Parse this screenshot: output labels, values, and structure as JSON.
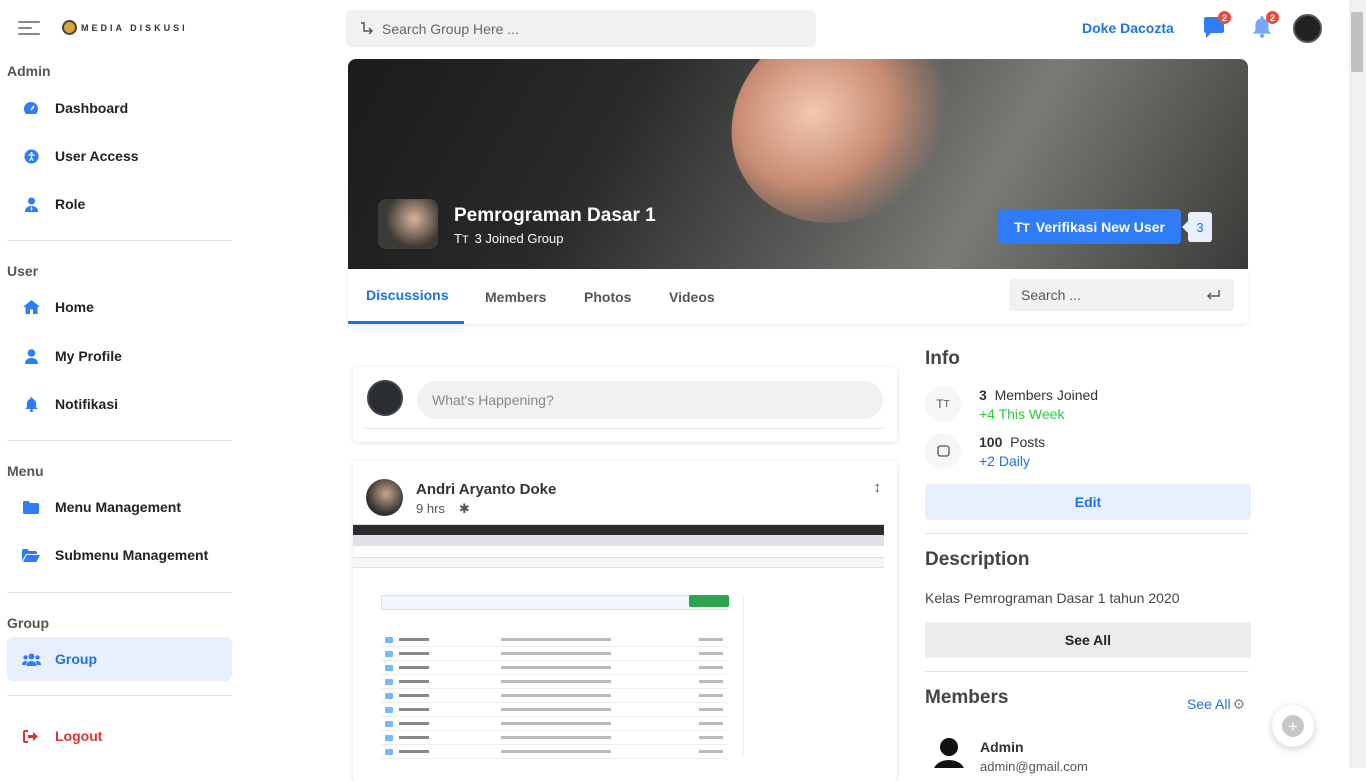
{
  "brand": {
    "logo_text": "MEDIA DISKUSI"
  },
  "sidebar": {
    "sections": [
      {
        "title": "Admin",
        "items": [
          {
            "label": "Dashboard",
            "icon": "gauge-icon"
          },
          {
            "label": "User Access",
            "icon": "accessibility-icon"
          },
          {
            "label": "Role",
            "icon": "user-tie-icon"
          }
        ]
      },
      {
        "title": "User",
        "items": [
          {
            "label": "Home",
            "icon": "home-icon"
          },
          {
            "label": "My Profile",
            "icon": "user-icon"
          },
          {
            "label": "Notifikasi",
            "icon": "bell-icon"
          }
        ]
      },
      {
        "title": "Menu",
        "items": [
          {
            "label": "Menu Management",
            "icon": "folder-icon"
          },
          {
            "label": "Submenu Management",
            "icon": "folder-open-icon"
          }
        ]
      },
      {
        "title": "Group",
        "items": [
          {
            "label": "Group",
            "icon": "users-icon",
            "active": true
          }
        ]
      }
    ],
    "logout": "Logout"
  },
  "header": {
    "search_placeholder": "Search Group Here ...",
    "username": "Doke Dacozta",
    "messages_badge": "2",
    "notifications_badge": "2"
  },
  "group": {
    "title": "Pemrograman Dasar 1",
    "joined": "3 Joined Group",
    "verify_button": "Verifikasi New User",
    "verify_count": "3"
  },
  "tabs": {
    "items": [
      "Discussions",
      "Members",
      "Photos",
      "Videos"
    ],
    "active": "Discussions",
    "search_placeholder": "Search ..."
  },
  "composer": {
    "placeholder": "What's Happening?"
  },
  "post": {
    "author": "Andri Aryanto Doke",
    "time": "9 hrs",
    "visibility_icon": "globe-icon",
    "menu_icon": "sort-icon"
  },
  "info": {
    "title": "Info",
    "members_count": "3",
    "members_label": "Members Joined",
    "members_sub": "+4 This Week",
    "posts_count": "100",
    "posts_label": "Posts",
    "posts_sub": "+2 Daily",
    "edit_button": "Edit"
  },
  "description": {
    "title": "Description",
    "text": "Kelas Pemrograman Dasar 1 tahun 2020",
    "see_all": "See All"
  },
  "members": {
    "title": "Members",
    "see_all": "See All",
    "first_name": "Admin",
    "first_email": "admin@gmail.com"
  },
  "colors": {
    "accent": "#1a73e8",
    "verify_button": "#2f7cf6",
    "badge": "#e74c3c",
    "logout": "#dd3333",
    "positive": "#2ecc40"
  }
}
